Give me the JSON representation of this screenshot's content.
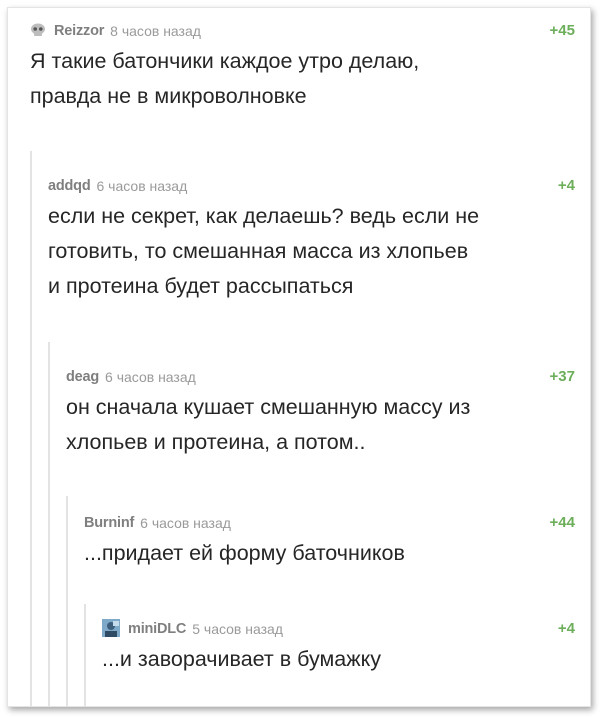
{
  "comments": [
    {
      "author": "Reizzor",
      "time": "8 часов назад",
      "score": "+45",
      "lines": [
        "Я такие батончики каждое утро делаю,",
        "правда не в микроволновке"
      ]
    },
    {
      "author": "addqd",
      "time": "6 часов назад",
      "score": "+4",
      "lines": [
        "если не секрет, как делаешь? ведь если не",
        "готовить, то смешанная масса из хлопьев",
        "и протеина будет рассыпаться"
      ]
    },
    {
      "author": "deag",
      "time": "6 часов назад",
      "score": "+37",
      "lines": [
        "он сначала кушает смешанную массу из",
        "хлопьев и протеина, а потом.."
      ]
    },
    {
      "author": "Burninf",
      "time": "6 часов назад",
      "score": "+44",
      "lines": [
        "...придает ей форму баточников"
      ]
    },
    {
      "author": "miniDLC",
      "time": "5 часов назад",
      "score": "+4",
      "lines": [
        "...и заворачивает в бумажку"
      ]
    }
  ],
  "colors": {
    "score": "#6cae5a",
    "author": "#7f7f7f",
    "time": "#9a9a9a",
    "text": "#262626",
    "thread_line": "#e3e3e3"
  },
  "icons": {
    "c0_avatar": "skull-avatar-icon",
    "c4_avatar": "user-avatar-icon"
  }
}
